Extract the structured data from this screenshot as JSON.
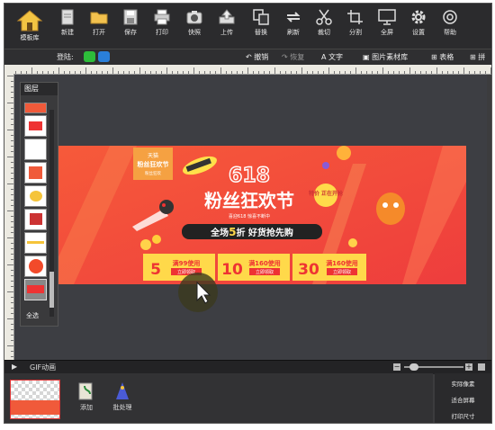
{
  "toolbar": {
    "home_label": "模板库",
    "tools": [
      {
        "label": "新建",
        "icon": "new-file-icon"
      },
      {
        "label": "打开",
        "icon": "open-folder-icon"
      },
      {
        "label": "保存",
        "icon": "save-icon"
      },
      {
        "label": "打印",
        "icon": "print-icon"
      },
      {
        "label": "快照",
        "icon": "camera-icon"
      },
      {
        "label": "上传",
        "icon": "upload-icon"
      },
      {
        "label": "替换",
        "icon": "replace-icon"
      },
      {
        "label": "刷新",
        "icon": "refresh-icon"
      },
      {
        "label": "裁切",
        "icon": "scissors-icon"
      },
      {
        "label": "分割",
        "icon": "split-icon"
      },
      {
        "label": "全屏",
        "icon": "monitor-icon"
      },
      {
        "label": "设置",
        "icon": "gear-icon"
      },
      {
        "label": "帮助",
        "icon": "help-icon"
      }
    ]
  },
  "subbar": {
    "login_label": "登陆:",
    "undo": "撤销",
    "redo": "恢复",
    "text": "文字",
    "image_lib": "图片素材库",
    "table": "表格",
    "more": "拼"
  },
  "layers": {
    "title": "图层",
    "select_all": "全选"
  },
  "banner": {
    "brand_top": "天猫",
    "brand_main": "粉丝狂欢节",
    "brand_sub": "粉丝狂欢",
    "number": "618",
    "headline": "粉丝狂欢节",
    "subline": "喜迎618 惊喜不断中",
    "promo_prefix": "全场",
    "promo_num": "5",
    "promo_suffix": "折 好货抢先购",
    "badge": "特价 正在开抢",
    "coupons": [
      {
        "amount": "5",
        "cond": "满99使用",
        "btn": "立即领取"
      },
      {
        "amount": "10",
        "cond": "满160使用",
        "btn": "立即领取"
      },
      {
        "amount": "30",
        "cond": "满160使用",
        "btn": "立即领取"
      }
    ]
  },
  "gif": {
    "label": "GIF动画"
  },
  "frames": {
    "add": "添加",
    "batch": "批处理"
  },
  "side_panel": {
    "items": [
      "实际像素",
      "适合屏幕",
      "打印尺寸"
    ]
  },
  "colors": {
    "banner_red": "#f2453a",
    "coupon_yellow": "#ffd94a",
    "toolbar_bg": "#2b2b2d"
  }
}
